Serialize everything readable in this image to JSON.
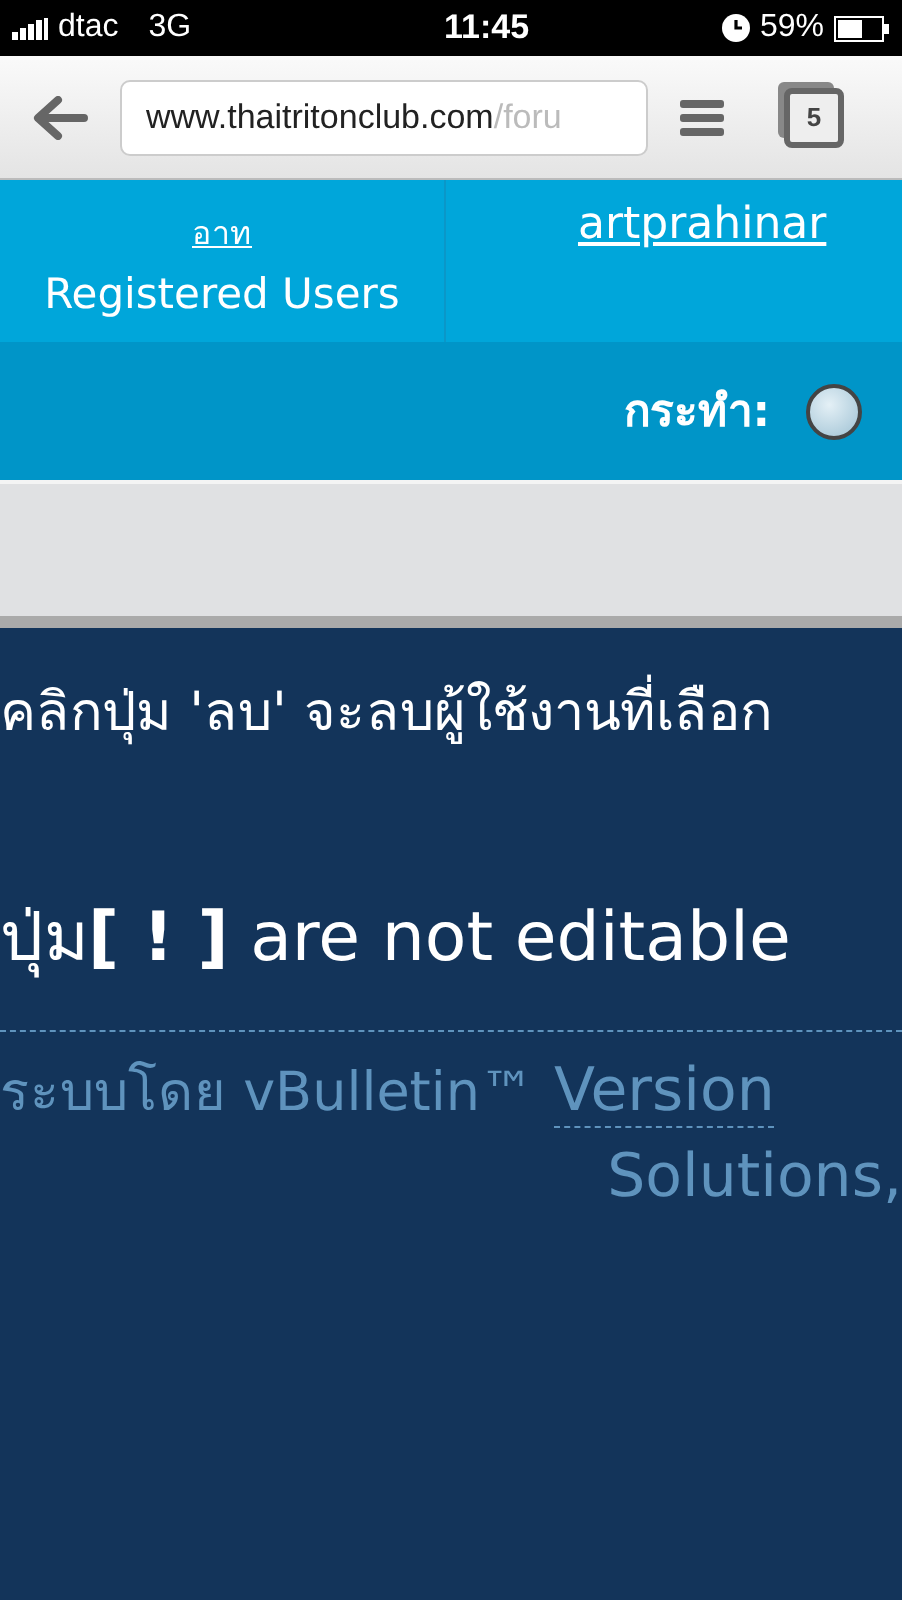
{
  "status_bar": {
    "carrier": "dtac",
    "network": "3G",
    "time": "11:45",
    "battery": "59%"
  },
  "browser": {
    "url": "www.thaitritonclub.com",
    "url_path": "/foru",
    "tab_count": "5"
  },
  "stats_row": {
    "cells": [
      {
        "link": "อาท",
        "label": "Registered Users"
      },
      {
        "link": "artprahinar"
      }
    ]
  },
  "action_bar": {
    "label": "กระทำ:",
    "radio": {
      "selected": false
    }
  },
  "notes": [
    "คลิกปุ่ม 'ลบ' จะลบผู้ใช้งานที่เลือก",
    "ปุ่ม**[ ! ]** are not editable"
  ],
  "footer": {
    "powered": "ระบบโดย vBulletin™",
    "version": "Version",
    "line2": "Solutions,"
  }
}
